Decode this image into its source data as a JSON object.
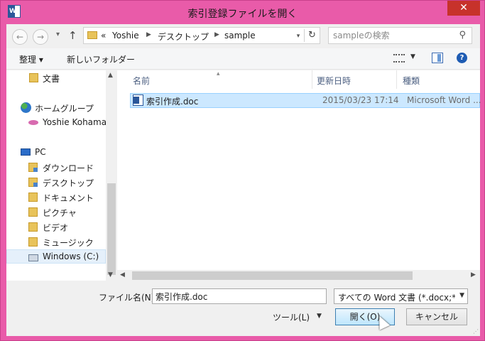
{
  "window": {
    "title": "索引登録ファイルを開く",
    "app_icon_text": "W",
    "close_glyph": "✕"
  },
  "address": {
    "back_glyph": "←",
    "forward_glyph": "→",
    "up_glyph": "↑",
    "refresh_glyph": "↻",
    "overflow": "«",
    "crumbs": [
      "Yoshie",
      "デスクトップ",
      "sample"
    ],
    "search_placeholder": "sampleの検索"
  },
  "toolbar": {
    "organize": "整理 ▾",
    "new_folder": "新しいフォルダー"
  },
  "nav": {
    "items": [
      {
        "label": "文書",
        "icon": "folder-icon"
      },
      {
        "label": "ホームグループ",
        "icon": "homegroup-icon"
      },
      {
        "label": "Yoshie Kohama",
        "icon": "user-icon"
      },
      {
        "label": "PC",
        "icon": "pc-icon"
      },
      {
        "label": "ダウンロード",
        "icon": "folder-icon"
      },
      {
        "label": "デスクトップ",
        "icon": "folder-icon"
      },
      {
        "label": "ドキュメント",
        "icon": "folder-icon"
      },
      {
        "label": "ピクチャ",
        "icon": "folder-icon"
      },
      {
        "label": "ビデオ",
        "icon": "folder-icon"
      },
      {
        "label": "ミュージック",
        "icon": "folder-icon"
      },
      {
        "label": "Windows (C:)",
        "icon": "drive-icon"
      }
    ]
  },
  "files": {
    "columns": [
      "名前",
      "更新日時",
      "種類"
    ],
    "rows": [
      {
        "name": "索引作成.doc",
        "modified": "2015/03/23 17:14",
        "type": "Microsoft Word ..."
      }
    ]
  },
  "bottom": {
    "filename_label": "ファイル名(N):",
    "filename_value": "索引作成.doc",
    "filetype": "すべての Word 文書 (*.docx;*.",
    "tools": "ツール(L)",
    "open": "開く(O)",
    "cancel": "キャンセル"
  },
  "colors": {
    "window_border": "#e95ba9",
    "selection": "#cce8ff",
    "accent": "#2b579a",
    "close_button": "#c7322b"
  }
}
